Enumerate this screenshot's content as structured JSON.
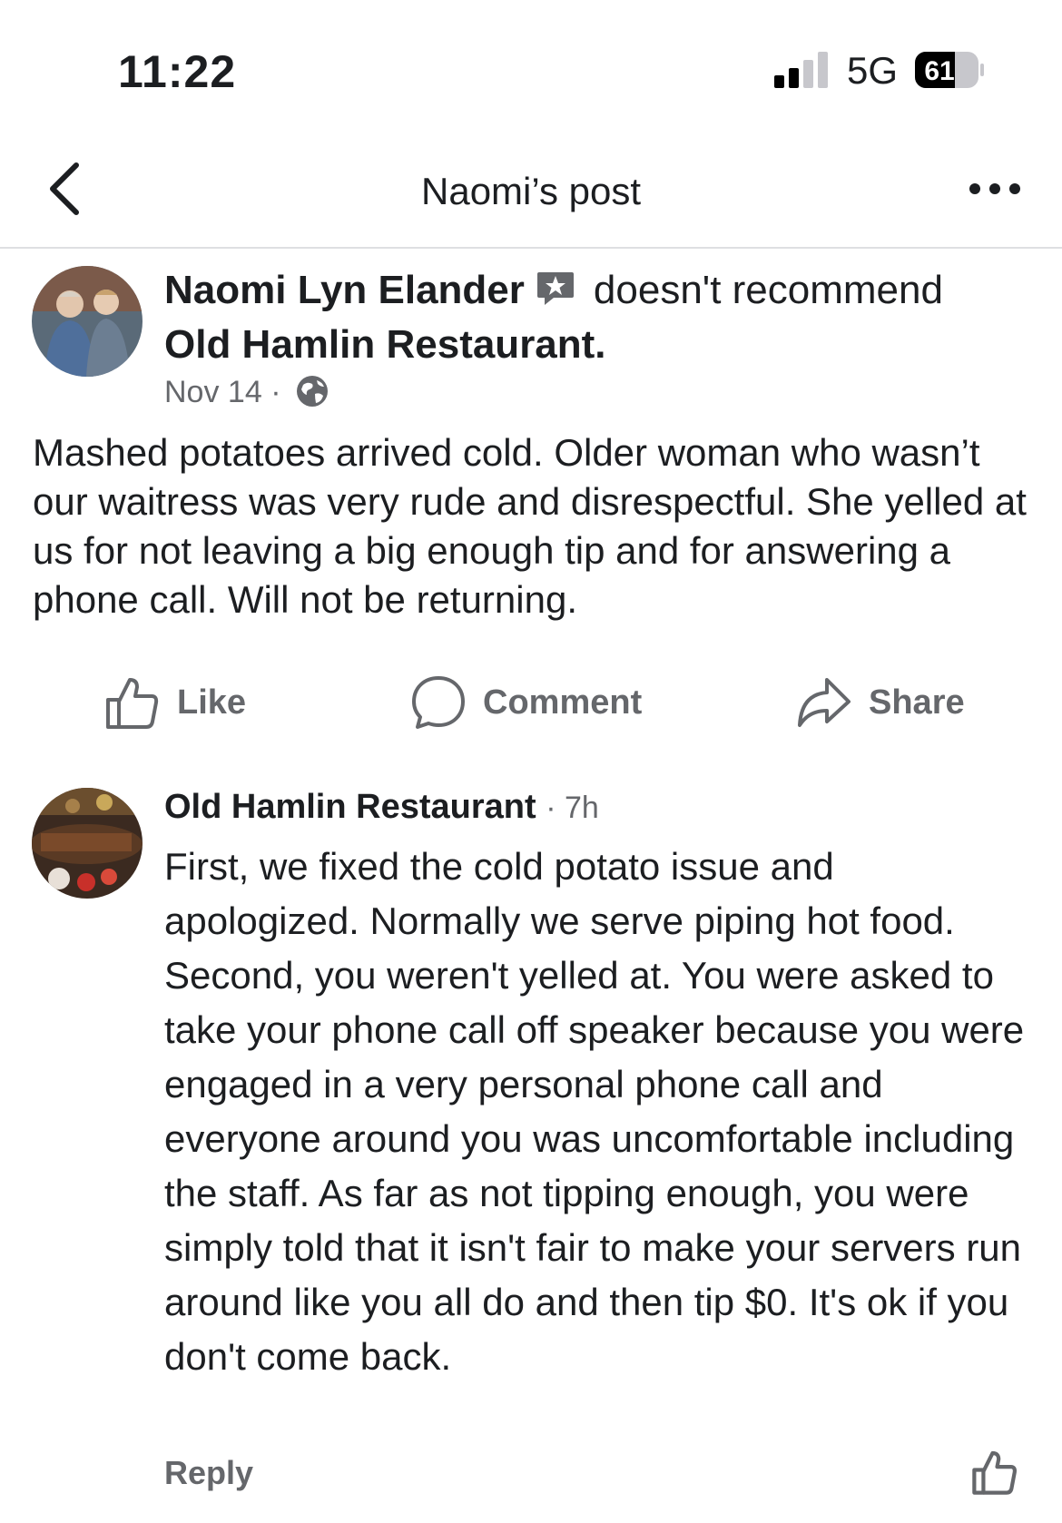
{
  "status_bar": {
    "time": "11:22",
    "network": "5G",
    "battery": "61"
  },
  "nav": {
    "title": "Naomi’s post"
  },
  "post": {
    "author": "Naomi Lyn Elander",
    "verb": "doesn't recommend",
    "page": "Old Hamlin Restaurant.",
    "date": "Nov 14",
    "separator": "·",
    "text": "Mashed potatoes arrived cold. Older woman who wasn’t our waitress was very rude and disrespectful. She yelled at us for not leaving a big enough tip and for answering a phone call. Will not be returning."
  },
  "actions": {
    "like": "Like",
    "comment": "Comment",
    "share": "Share"
  },
  "comment": {
    "author": "Old Hamlin Restaurant",
    "time": "· 7h",
    "text": "First, we fixed the cold potato issue and apologized. Normally we serve piping hot food. Second, you weren't yelled at. You were asked to take your phone call off speaker because you were engaged in a very personal phone call and everyone around you was uncomfortable including the staff. As far as not tipping enough, you were simply told that it isn't fair to make your servers run around like you all do and then tip $0. It's ok if you don't come back.",
    "reply_label": "Reply"
  },
  "icons": {
    "back": "chevron-left-icon",
    "more": "more-dots-icon",
    "badge": "review-star-icon",
    "audience": "globe-icon",
    "like": "thumbs-up-icon",
    "comment": "comment-bubble-icon",
    "share": "share-arrow-icon"
  },
  "colors": {
    "text": "#1c1e21",
    "secondary": "#65676b",
    "divider": "#dedfe2"
  }
}
